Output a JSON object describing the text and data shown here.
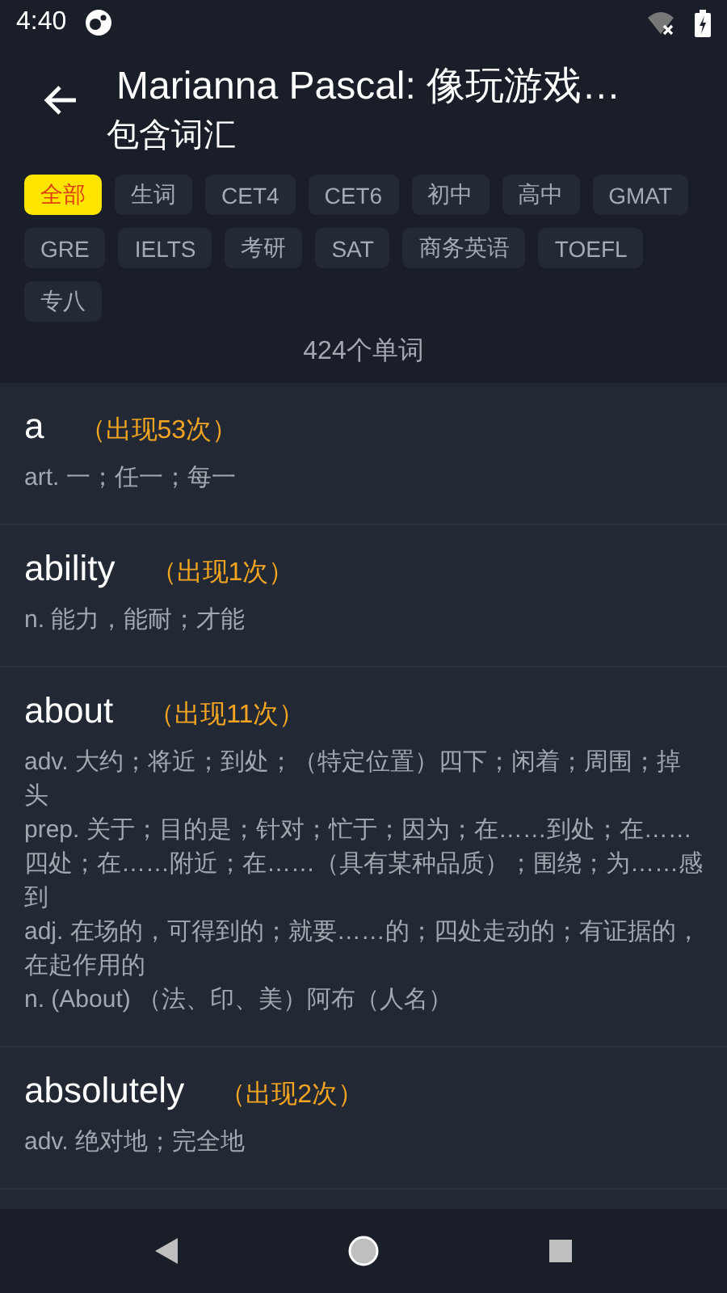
{
  "status_bar": {
    "time": "4:40"
  },
  "header": {
    "title": "Marianna Pascal: 像玩游戏…",
    "subtitle": "包含词汇"
  },
  "filters": [
    {
      "label": "全部",
      "selected": true
    },
    {
      "label": "生词",
      "selected": false
    },
    {
      "label": "CET4",
      "selected": false
    },
    {
      "label": "CET6",
      "selected": false
    },
    {
      "label": "初中",
      "selected": false
    },
    {
      "label": "高中",
      "selected": false
    },
    {
      "label": "GMAT",
      "selected": false
    },
    {
      "label": "GRE",
      "selected": false
    },
    {
      "label": "IELTS",
      "selected": false
    },
    {
      "label": "考研",
      "selected": false
    },
    {
      "label": "SAT",
      "selected": false
    },
    {
      "label": "商务英语",
      "selected": false
    },
    {
      "label": "TOEFL",
      "selected": false
    },
    {
      "label": "专八",
      "selected": false
    }
  ],
  "word_count": "424个单词",
  "words": [
    {
      "word": "a",
      "occurrences": "（出现53次）",
      "definitions": [
        "art. 一；任一；每一"
      ]
    },
    {
      "word": "ability",
      "occurrences": "（出现1次）",
      "definitions": [
        "n. 能力，能耐；才能"
      ]
    },
    {
      "word": "about",
      "occurrences": "（出现11次）",
      "definitions": [
        "adv. 大约；将近；到处；（特定位置）四下；闲着；周围；掉头",
        "prep. 关于；目的是；针对；忙于；因为；在……到处；在……四处；在……附近；在……（具有某种品质）；围绕；为……感到",
        "adj. 在场的，可得到的；就要……的；四处走动的；有证据的，在起作用的",
        "n. (About) （法、印、美）阿布（人名）"
      ]
    },
    {
      "word": "absolutely",
      "occurrences": "（出现2次）",
      "definitions": [
        "adv. 绝对地；完全地"
      ]
    }
  ]
}
